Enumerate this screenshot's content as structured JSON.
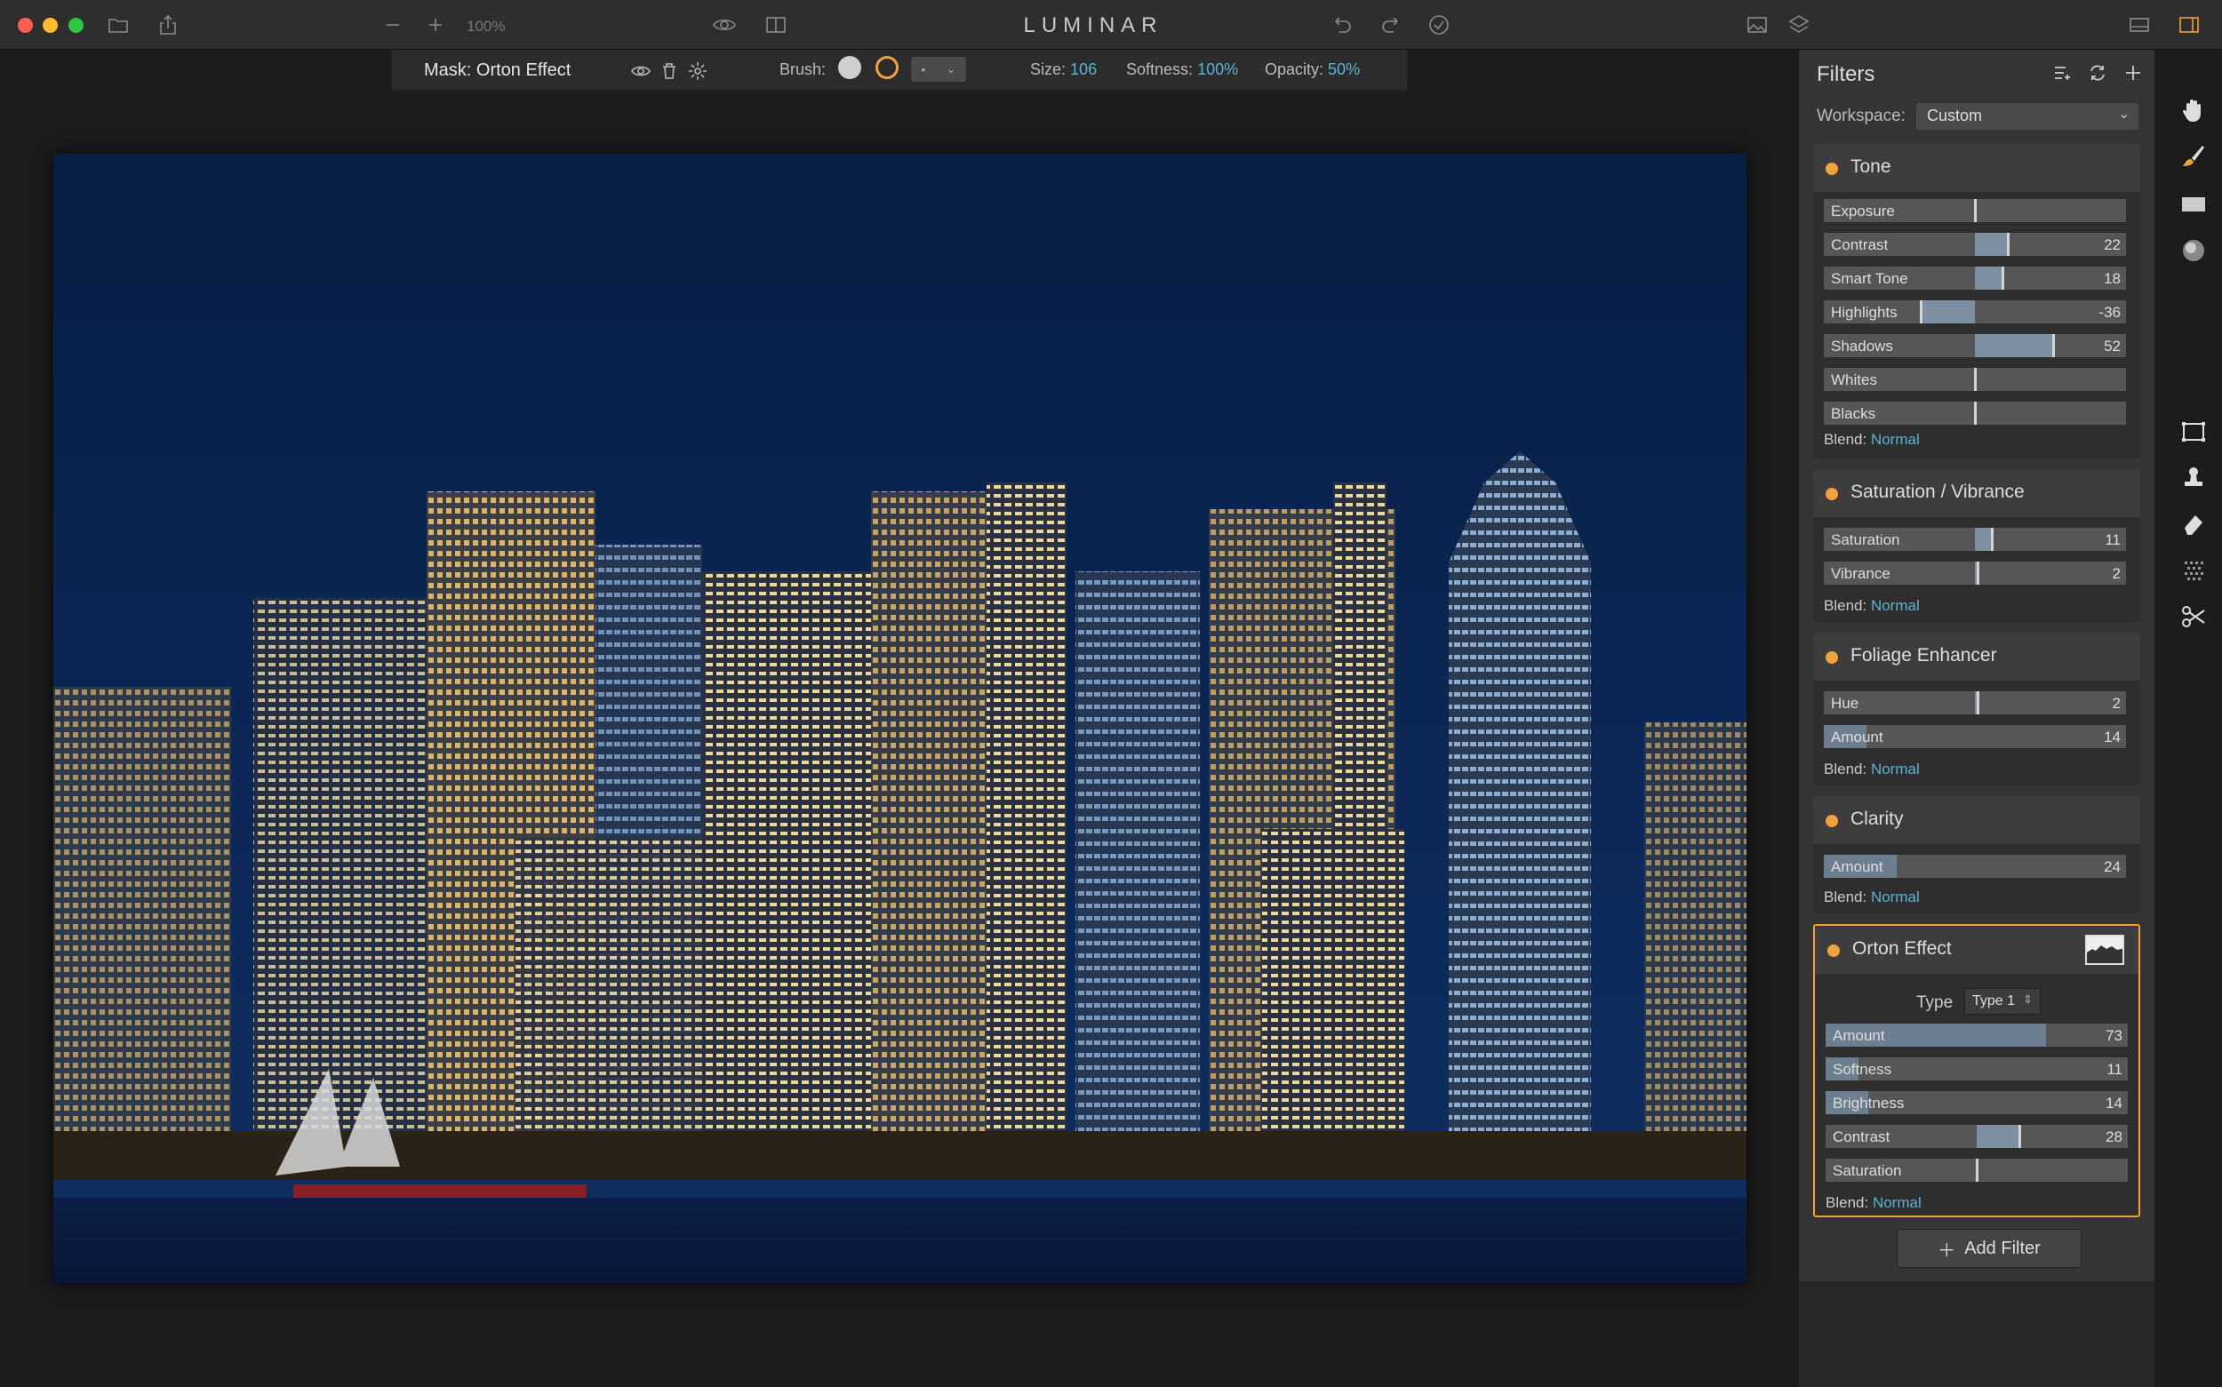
{
  "app": {
    "title": "LUMINAR",
    "zoom": "100%"
  },
  "colors": {
    "accent": "#f0a23b",
    "value": "#5ab4d1",
    "panel": "#353535"
  },
  "toolbar_icons": [
    "folder-icon",
    "share-icon",
    "zoom-out-icon",
    "zoom-in-icon",
    "eye-icon",
    "compare-icon",
    "undo-icon",
    "redo-icon",
    "apply-icon",
    "image-icon",
    "layers-icon",
    "layout-icon",
    "sidebar-icon"
  ],
  "maskbar": {
    "mask_label": "Mask:",
    "mask_name": "Orton Effect",
    "brush_label": "Brush:",
    "size_label": "Size:",
    "size_value": "106",
    "softness_label": "Softness:",
    "softness_value": "100%",
    "opacity_label": "Opacity:",
    "opacity_value": "50%",
    "brush_select": "•"
  },
  "panel": {
    "title": "Filters",
    "workspace_label": "Workspace:",
    "workspace_value": "Custom",
    "add_filter": "Add Filter",
    "blend_label": "Blend:",
    "blend_value": "Normal"
  },
  "filters": [
    {
      "name": "Tone",
      "sliders": [
        {
          "label": "Exposure",
          "value": 0,
          "display": ""
        },
        {
          "label": "Contrast",
          "value": 22,
          "display": "22"
        },
        {
          "label": "Smart Tone",
          "value": 18,
          "display": "18"
        },
        {
          "label": "Highlights",
          "value": -36,
          "display": "-36"
        },
        {
          "label": "Shadows",
          "value": 52,
          "display": "52"
        },
        {
          "label": "Whites",
          "value": 0,
          "display": ""
        },
        {
          "label": "Blacks",
          "value": 0,
          "display": ""
        }
      ]
    },
    {
      "name": "Saturation / Vibrance",
      "sliders": [
        {
          "label": "Saturation",
          "value": 11,
          "display": "11"
        },
        {
          "label": "Vibrance",
          "value": 2,
          "display": "2"
        }
      ]
    },
    {
      "name": "Foliage Enhancer",
      "sliders": [
        {
          "label": "Hue",
          "value": 2,
          "display": "2"
        },
        {
          "label": "Amount",
          "value": 14,
          "display": "14"
        }
      ]
    },
    {
      "name": "Clarity",
      "sliders": [
        {
          "label": "Amount",
          "value": 24,
          "display": "24"
        }
      ]
    },
    {
      "name": "Orton Effect",
      "type_label": "Type",
      "type_value": "Type 1",
      "sliders": [
        {
          "label": "Amount",
          "value": 73,
          "display": "73"
        },
        {
          "label": "Softness",
          "value": 11,
          "display": "11"
        },
        {
          "label": "Brightness",
          "value": 14,
          "display": "14"
        },
        {
          "label": "Contrast",
          "value": 28,
          "display": "28"
        },
        {
          "label": "Saturation",
          "value": 0,
          "display": ""
        }
      ]
    }
  ],
  "tools": [
    "hand-icon",
    "brush-icon",
    "gradient-icon",
    "radial-icon",
    "crop-icon",
    "clone-stamp-icon",
    "eraser-icon",
    "noise-icon",
    "scissors-icon"
  ]
}
